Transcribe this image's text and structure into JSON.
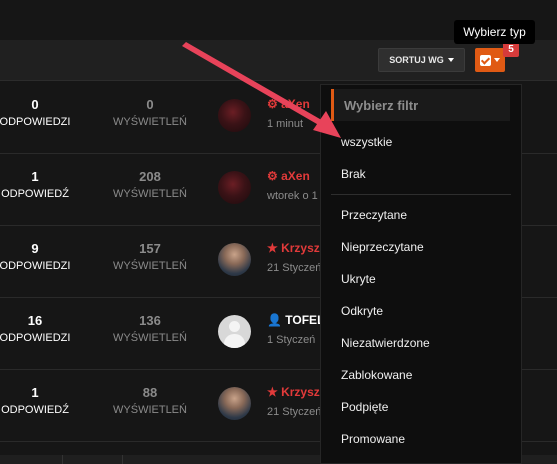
{
  "toolbar": {
    "sort_label": "SORTUJ WG",
    "filter_badge": "5",
    "tooltip": "Wybierz typ"
  },
  "colors": {
    "accent": "#e05a14",
    "badge": "#d63b3b",
    "author_red": "#e23a3a",
    "muted": "#8b8b8b"
  },
  "topics": [
    {
      "replies": "0",
      "replies_label": "ODPOWIEDZI",
      "views": "0",
      "views_label": "WYŚWIETLEŃ",
      "author": "aXen",
      "author_icon": "cog-icon",
      "when": "1 minut",
      "avatar": "dark"
    },
    {
      "replies": "1",
      "replies_label": "ODPOWIEDŹ",
      "views": "208",
      "views_label": "WYŚWIETLEŃ",
      "author": "aXen",
      "author_icon": "cog-icon",
      "when": "wtorek o 1",
      "avatar": "dark"
    },
    {
      "replies": "9",
      "replies_label": "ODPOWIEDZI",
      "views": "157",
      "views_label": "WYŚWIETLEŃ",
      "author": "Krzysz",
      "author_icon": "star-icon",
      "when": "21 Styczeń",
      "avatar": "man"
    },
    {
      "replies": "16",
      "replies_label": "ODPOWIEDZI",
      "views": "136",
      "views_label": "WYŚWIETLEŃ",
      "author": "TOFEL",
      "author_icon": "user-icon",
      "when": "1 Styczeń",
      "avatar": "grey"
    },
    {
      "replies": "1",
      "replies_label": "ODPOWIEDŹ",
      "views": "88",
      "views_label": "WYŚWIETLEŃ",
      "author": "Krzysz",
      "author_icon": "star-icon",
      "when": "21 Styczeń",
      "avatar": "man"
    }
  ],
  "dropdown": {
    "header": "Wybierz filtr",
    "items": [
      "wszystkie",
      "Brak",
      "Przeczytane",
      "Nieprzeczytane",
      "Ukryte",
      "Odkryte",
      "Niezatwierdzone",
      "Zablokowane",
      "Podpięte",
      "Promowane"
    ]
  }
}
